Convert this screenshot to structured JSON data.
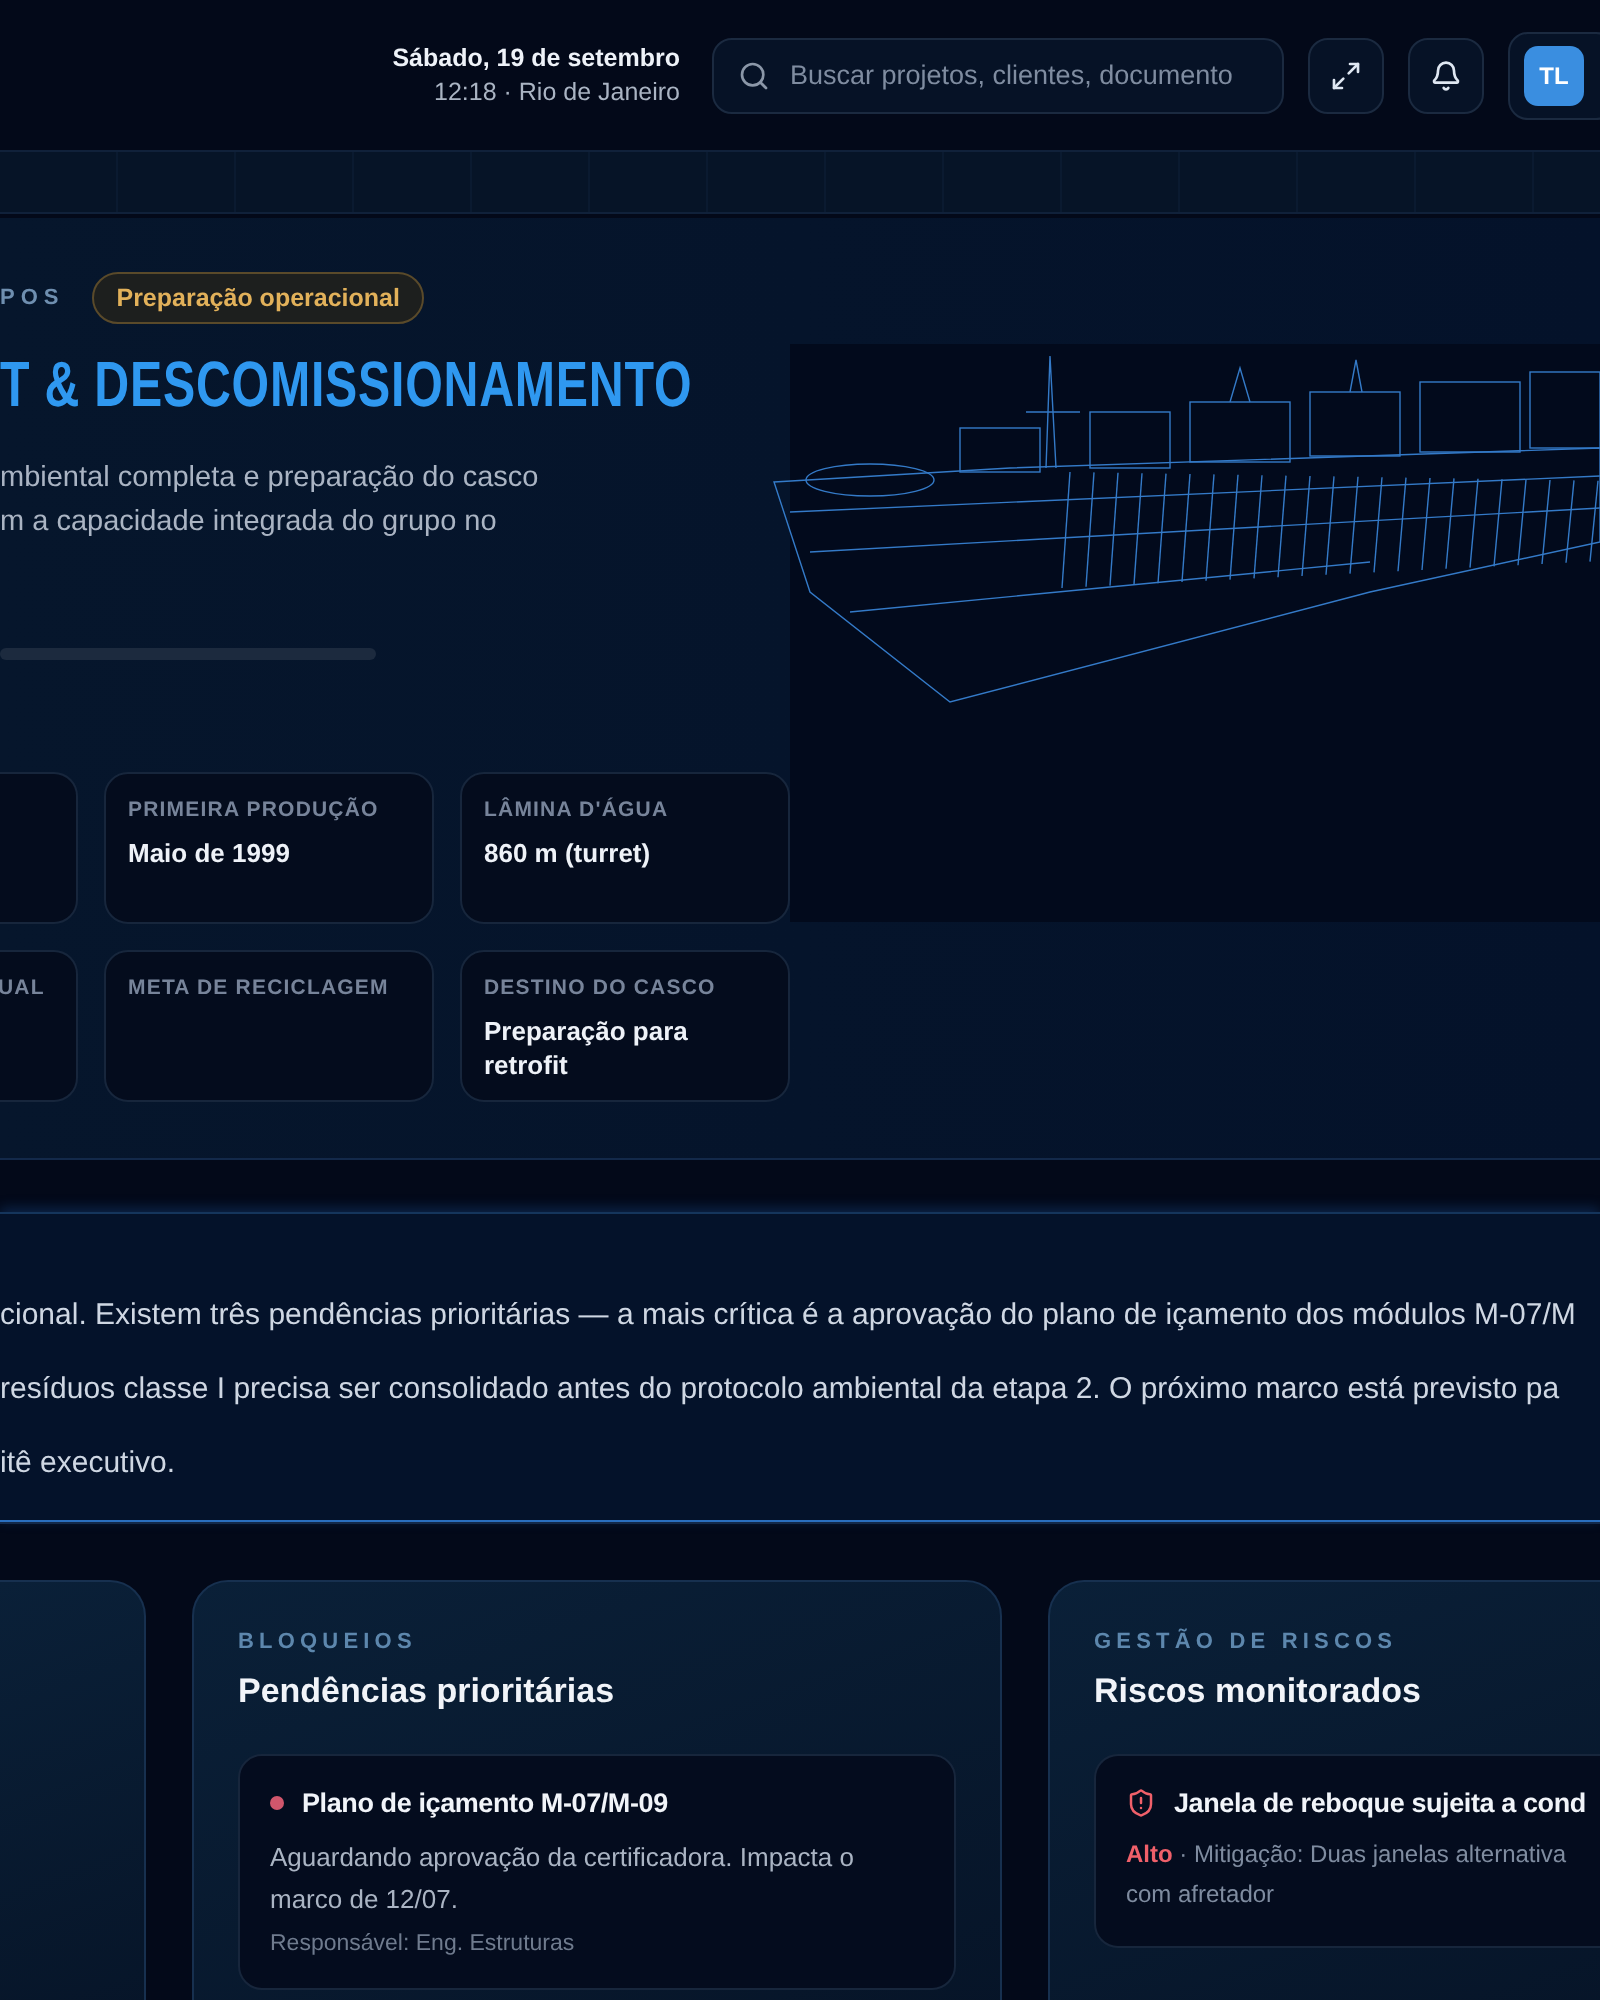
{
  "header": {
    "date": "Sábado, 19 de setembro",
    "time_place": "12:18 · Rio de Janeiro",
    "search": {
      "placeholder": "Buscar projetos, clientes, documento"
    },
    "avatar": "TL"
  },
  "hero": {
    "eyebrow": "POS",
    "badge": "Preparação operacional",
    "title": "T & DESCOMISSIONAMENTO",
    "description_lines": [
      "mbiental completa e preparação do casco",
      "m a capacidade integrada do grupo no"
    ],
    "stats": [
      {
        "label": "PRIMEIRA PRODUÇÃO",
        "value": "Maio de 1999"
      },
      {
        "label": "LÂMINA D'ÁGUA",
        "value": "860 m (turret)"
      },
      {
        "label": "UAL",
        "cut": true
      },
      {
        "label": "META DE RECICLAGEM"
      },
      {
        "label": "DESTINO DO CASCO",
        "value": "Preparação para retrofit"
      }
    ]
  },
  "summary": {
    "lines": [
      "cional. Existem três pendências prioritárias — a mais crítica é a aprovação do plano de içamento dos módulos M-07/M",
      "resíduos classe I precisa ser consolidado antes do protocolo ambiental da etapa 2. O próximo marco está previsto pa",
      "itê executivo."
    ]
  },
  "blockers": {
    "eyebrow": "BLOQUEIOS",
    "title": "Pendências prioritárias",
    "items": [
      {
        "title": "Plano de içamento M-07/M-09",
        "color": "#d0566c",
        "description": "Aguardando aprovação da certificadora. Impacta o marco de 12/07.",
        "owner": "Responsável: Eng. Estruturas"
      }
    ]
  },
  "risks": {
    "eyebrow": "GESTÃO DE RISCOS",
    "title": "Riscos monitorados",
    "items": [
      {
        "title": "Janela de reboque sujeita a cond",
        "severity": "Alto",
        "color": "#f0606a",
        "mitigation": "· Mitigação: Duas janelas alternativa",
        "mitigation_2": "com afretador"
      }
    ]
  }
}
